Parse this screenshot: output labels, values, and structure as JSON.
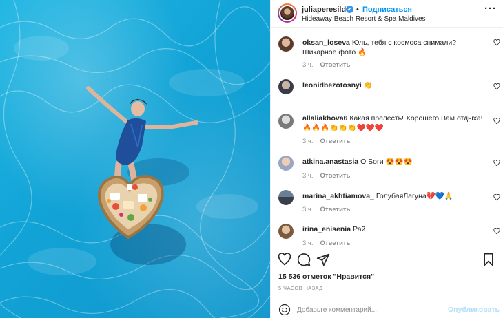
{
  "post": {
    "username": "juliaperesild",
    "verified_glyph": "✔",
    "separator": "•",
    "follow_label": "Подписаться",
    "location": "Hideaway Beach Resort & Spa Maldives",
    "more_label": "···",
    "image_description_icon": "pool-photo"
  },
  "comments": [
    {
      "username": "oksan_loseva",
      "text": "Юль, тебя с космоса снимали? Шикарное фото 🔥",
      "time": "3 ч.",
      "reply": "Ответить"
    },
    {
      "username": "leonidbezotosnyi",
      "text": "👏",
      "time": "",
      "reply": ""
    },
    {
      "username": "allaliakhova6",
      "text": "Какая прелесть! Хорошего Вам отдыха! 🔥🔥🔥👏👏👏❤️❤️❤️",
      "time": "3 ч.",
      "reply": "Ответить"
    },
    {
      "username": "atkina.anastasia",
      "text": "О Боги 😍😍😍",
      "time": "3 ч.",
      "reply": "Ответить"
    },
    {
      "username": "marina_akhtiamova_",
      "text": "ГолубаяЛагуна💔💙🙏",
      "time": "3 ч.",
      "reply": "Ответить"
    },
    {
      "username": "irina_enisenia",
      "text": "Рай",
      "time": "3 ч.",
      "reply": "Ответить"
    }
  ],
  "actions": {
    "likes": "15 536 отметок \"Нравится\"",
    "time_ago": "5 ЧАСОВ НАЗАД",
    "comment_placeholder": "Добавьте комментарий...",
    "publish_label": "Опубликовать"
  },
  "colors": {
    "accent": "#0095f6",
    "publish_disabled": "#b2dffc",
    "pool": "#12a3d6",
    "muted": "#8e8e8e"
  }
}
